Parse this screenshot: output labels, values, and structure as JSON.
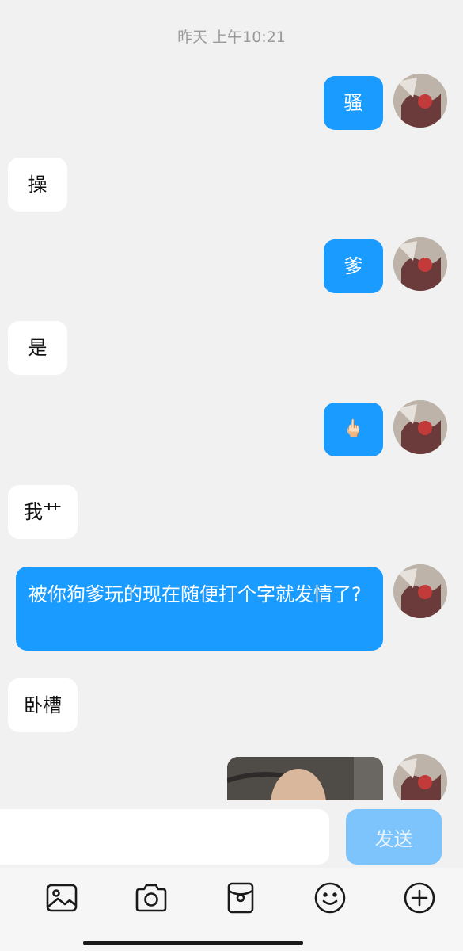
{
  "chat": {
    "timestamp": "昨天 上午10:21",
    "messages": [
      {
        "direction": "out",
        "text": "骚"
      },
      {
        "direction": "in",
        "text": "操"
      },
      {
        "direction": "out",
        "text": "爹"
      },
      {
        "direction": "in",
        "text": "是"
      },
      {
        "direction": "out",
        "text": "🖕🏻"
      },
      {
        "direction": "in",
        "text": "我艹"
      },
      {
        "direction": "out",
        "text": "被你狗爹玩的现在随便打个字就发情了?"
      },
      {
        "direction": "in",
        "text": "卧槽"
      },
      {
        "direction": "out",
        "type": "image"
      }
    ]
  },
  "composer": {
    "input_value": "",
    "input_placeholder": "",
    "send_label": "发送"
  },
  "toolbar": {
    "icons": [
      "image-icon",
      "camera-icon",
      "red-packet-icon",
      "emoji-icon",
      "plus-icon"
    ]
  },
  "colors": {
    "background": "#f1f1f1",
    "outgoing_bubble": "#1a9bff",
    "incoming_bubble": "#ffffff",
    "send_button": "#7cc4fb"
  }
}
